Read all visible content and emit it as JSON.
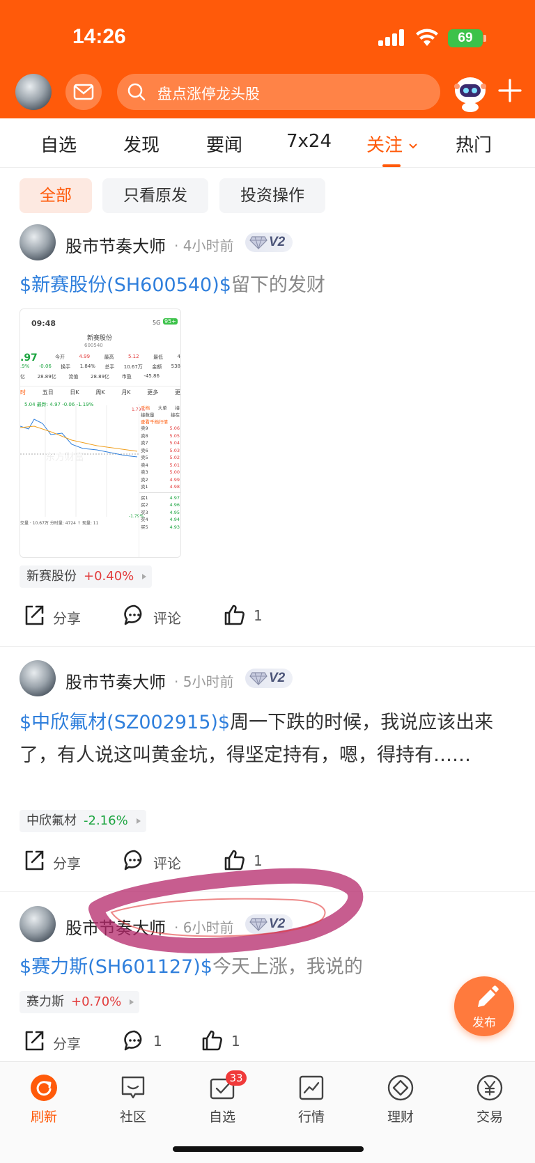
{
  "status_bar": {
    "time": "14:26",
    "battery": "69"
  },
  "header": {
    "search_placeholder": "盘点涨停龙头股"
  },
  "tabs": [
    {
      "label": "自选"
    },
    {
      "label": "发现"
    },
    {
      "label": "要闻"
    },
    {
      "label": "7x24"
    },
    {
      "label": "关注",
      "active": true
    },
    {
      "label": "热门"
    }
  ],
  "filters": [
    {
      "label": "全部",
      "active": true
    },
    {
      "label": "只看原发"
    },
    {
      "label": "投资操作"
    }
  ],
  "posts": [
    {
      "author": "股市节奏大师",
      "time": "· 4小时前",
      "badge": "V2",
      "stock_link": "$新赛股份(SH600540)$",
      "text": "留下的发财",
      "tag_name": "新赛股份",
      "tag_change": "+0.40%",
      "share": "分享",
      "comment": "评论",
      "likes": "1",
      "image": {
        "time": "09:48",
        "network": "5G",
        "battery": "95+",
        "title": "新赛股份",
        "code": "600540",
        "price": ".97",
        "row1": [
          "今开",
          "4.99",
          "最高",
          "5.12",
          "最低",
          "4"
        ],
        "row2": [
          ".9%",
          "-0.06",
          "换手",
          "1.84%",
          "总手",
          "10.67万",
          "金额",
          "538"
        ],
        "row3": [
          "亿",
          "28.89亿",
          "流值",
          "28.89亿",
          "市盈",
          "-45.86"
        ],
        "periods": [
          "时",
          "五日",
          "日K",
          "周K",
          "月K",
          "更多",
          "更"
        ],
        "line_info": "5.04  最新: 4.97 -0.06 -1.19%",
        "pct_top": "1.79%",
        "pct_bottom": "-1.79%",
        "panel_tabs": [
          "千档",
          "大单",
          "接"
        ],
        "panel_sub": [
          "接数量",
          "接在"
        ],
        "panel_link": "查看千档行情",
        "asks": [
          {
            "l": "卖9",
            "p": "5.06"
          },
          {
            "l": "卖8",
            "p": "5.05"
          },
          {
            "l": "卖7",
            "p": "5.04"
          },
          {
            "l": "卖6",
            "p": "5.03"
          },
          {
            "l": "卖5",
            "p": "5.02"
          },
          {
            "l": "卖4",
            "p": "5.01"
          },
          {
            "l": "卖3",
            "p": "5.00"
          },
          {
            "l": "卖2",
            "p": "4.99"
          },
          {
            "l": "卖1",
            "p": "4.98"
          }
        ],
        "bids": [
          {
            "l": "买1",
            "p": "4.97"
          },
          {
            "l": "买2",
            "p": "4.96"
          },
          {
            "l": "买3",
            "p": "4.95"
          },
          {
            "l": "买4",
            "p": "4.94"
          },
          {
            "l": "买5",
            "p": "4.93"
          }
        ],
        "volume_line": "交量 · 10.67万 分时量: 4724 ↑ 现量: 11",
        "watermark": "东方财富"
      }
    },
    {
      "author": "股市节奏大师",
      "time": "· 5小时前",
      "badge": "V2",
      "stock_link": "$中欣氟材(SZ002915)$",
      "text": "周一下跌的时候，我说应该出来了，有人说这叫黄金坑，得坚定持有，嗯，得持有……",
      "tag_name": "中欣氟材",
      "tag_change": "-2.16%",
      "share": "分享",
      "comment": "评论",
      "likes": "1"
    },
    {
      "author": "股市节奏大师",
      "time": "· 6小时前",
      "badge": "V2",
      "stock_link": "$赛力斯(SH601127)$",
      "text": "今天上涨，我说的",
      "tag_name": "赛力斯",
      "tag_change": "+0.70%",
      "share": "分享",
      "comment": "1",
      "likes": "1"
    }
  ],
  "fab": {
    "label": "发布"
  },
  "bottom_nav": [
    {
      "label": "刷新",
      "icon": "refresh-icon",
      "active": true
    },
    {
      "label": "社区",
      "icon": "community-icon"
    },
    {
      "label": "自选",
      "icon": "watchlist-icon",
      "badge": "33"
    },
    {
      "label": "行情",
      "icon": "market-icon"
    },
    {
      "label": "理财",
      "icon": "wealth-icon"
    },
    {
      "label": "交易",
      "icon": "trade-icon"
    }
  ],
  "colors": {
    "brand": "#ff5a0a",
    "link": "#2f7fdc",
    "up": "#e23c3c",
    "down": "#1ba43f"
  }
}
